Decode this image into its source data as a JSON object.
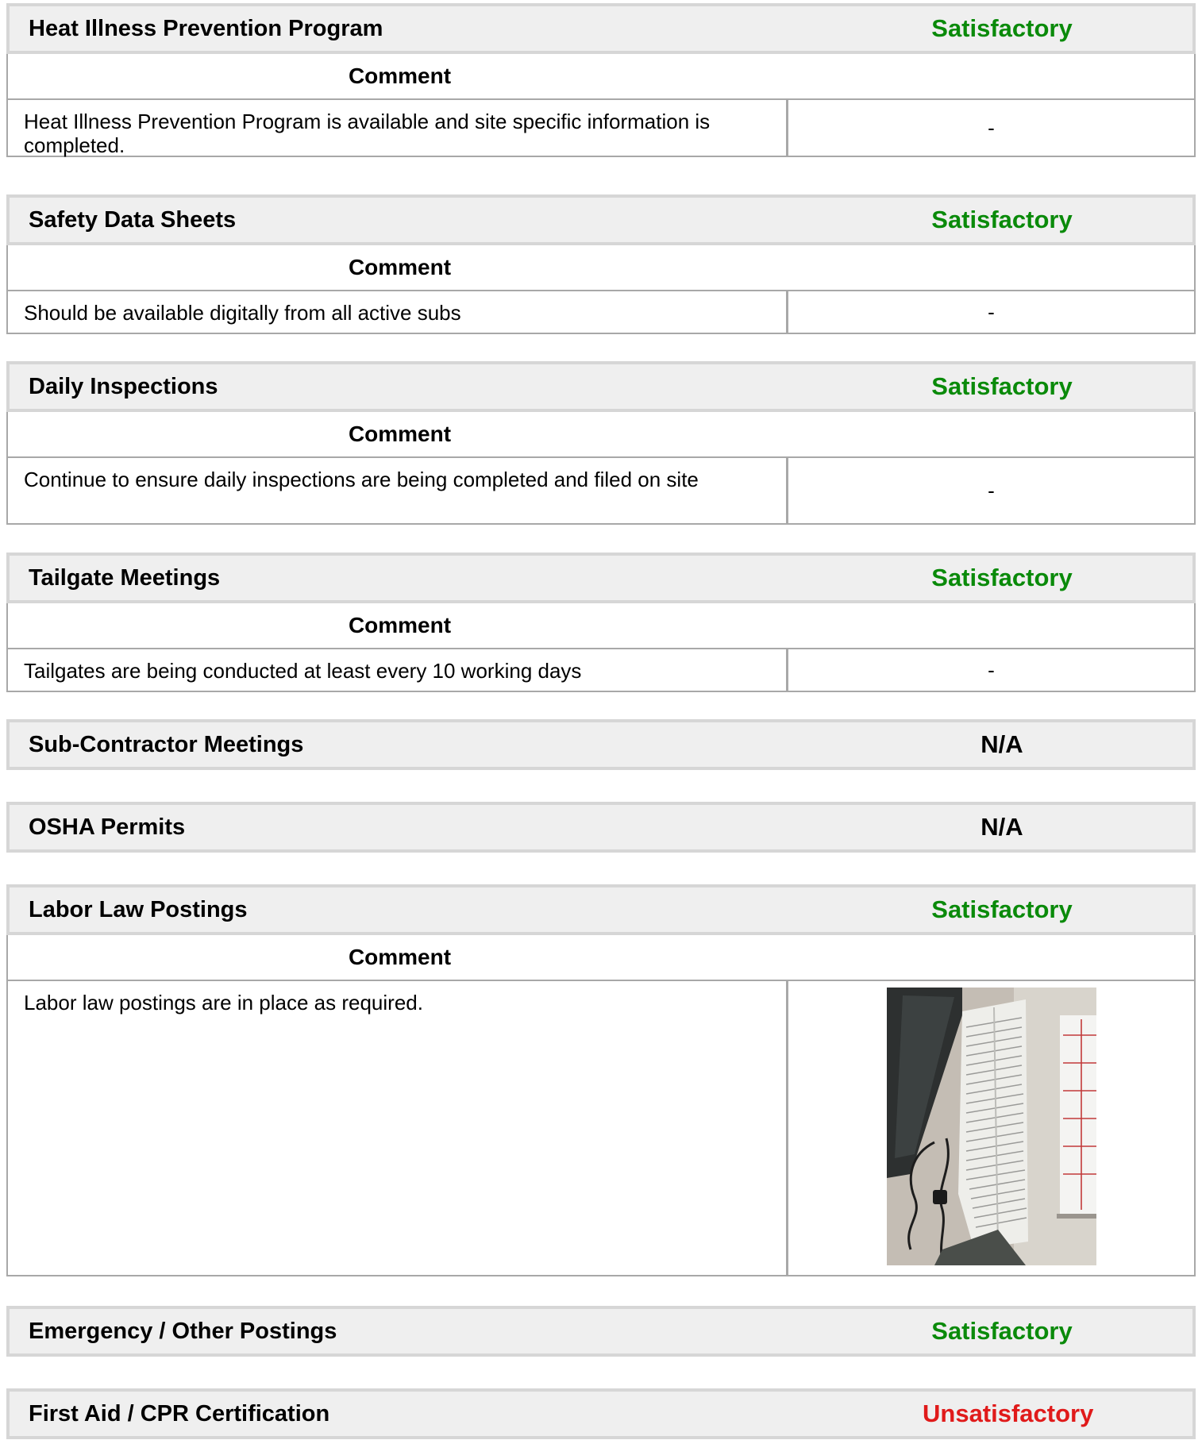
{
  "comment_header": "Comment",
  "sections": {
    "heat": {
      "title": "Heat Illness Prevention Program",
      "status": "Satisfactory",
      "comment": "Heat Illness Prevention Program is available and site specific information is completed.",
      "value": "-"
    },
    "sds": {
      "title": "Safety Data Sheets",
      "status": "Satisfactory",
      "comment": "Should be available digitally from all active subs",
      "value": "-"
    },
    "daily": {
      "title": "Daily Inspections",
      "status": "Satisfactory",
      "comment": "Continue to ensure daily inspections are being completed and filed on site",
      "value": "-"
    },
    "tailgate": {
      "title": "Tailgate Meetings",
      "status": "Satisfactory",
      "comment": "Tailgates are being conducted at least every 10 working days",
      "value": "-"
    },
    "subcontractor": {
      "title": "Sub-Contractor Meetings",
      "status": "N/A"
    },
    "osha": {
      "title": "OSHA Permits",
      "status": "N/A"
    },
    "labor": {
      "title": "Labor Law Postings",
      "status": "Satisfactory",
      "comment": "Labor law postings are in place as required."
    },
    "emergency": {
      "title": "Emergency / Other Postings",
      "status": "Satisfactory"
    },
    "firstaid": {
      "title": "First Aid / CPR Certification",
      "status": "Unsatisfactory"
    }
  },
  "colors": {
    "satisfactory": "#0a8a0a",
    "unsatisfactory": "#e01a1a",
    "na": "#000000",
    "header_bg": "#efefef"
  }
}
